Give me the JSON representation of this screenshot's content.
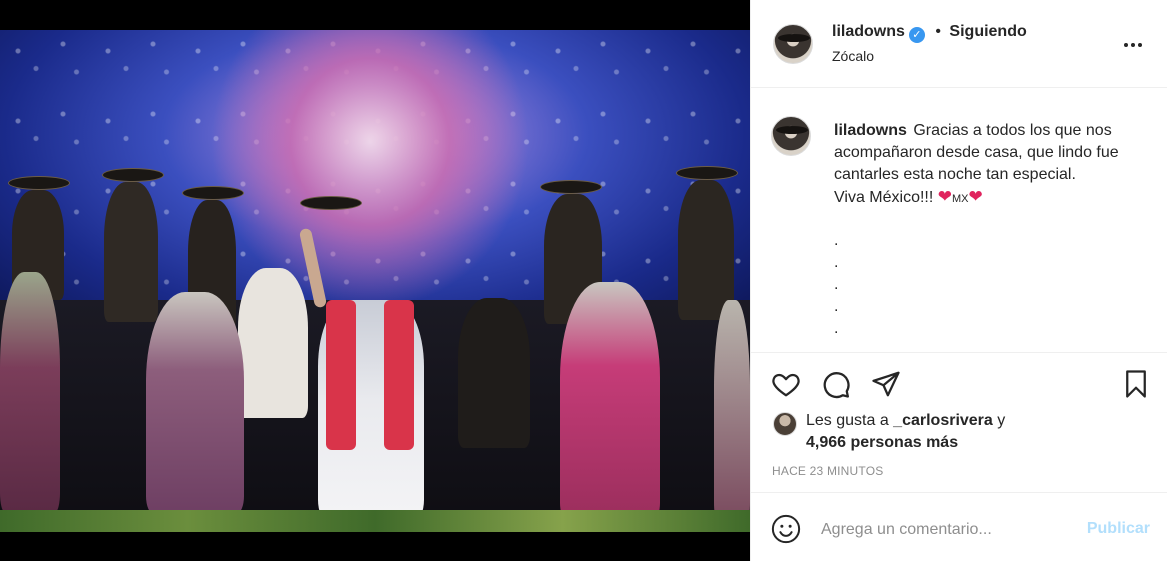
{
  "post": {
    "image_alt": "",
    "author": {
      "username": "liladowns",
      "verified": true,
      "follow_state": "Siguiendo",
      "separator": "•",
      "location": "Zócalo"
    },
    "caption": {
      "username": "liladowns",
      "text": "Gracias a todos los que nos acompañaron desde casa, que lindo fue cantarles esta noche tan especial.",
      "line2_text": "Viva México!!!",
      "heart1": "❤",
      "mx": "MX",
      "heart2": "❤",
      "dots": [
        ".",
        ".",
        ".",
        ".",
        "."
      ]
    },
    "likes": {
      "prefix": "Les gusta a ",
      "liker": "_carlosrivera",
      "middle": " y",
      "count_text": "4,966 personas más"
    },
    "timestamp": "HACE 23 MINUTOS",
    "comment": {
      "placeholder": "Agrega un comentario...",
      "publish_label": "Publicar"
    }
  },
  "colors": {
    "verified_blue": "#3897f0",
    "publish_disabled": "#b2dffc",
    "muted_text": "#8e8e8e",
    "heart": "#e0245e"
  }
}
